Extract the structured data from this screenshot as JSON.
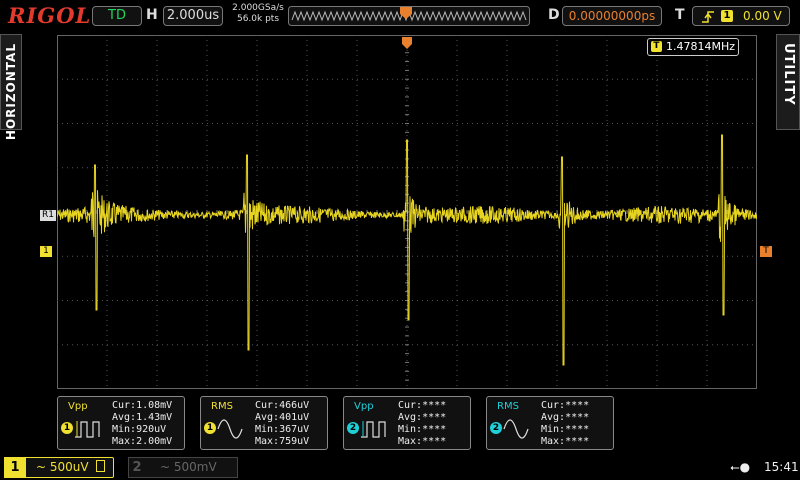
{
  "header": {
    "brand": "RIGOL",
    "run_state": "TD",
    "horizontal_label": "H",
    "timebase": "2.000us",
    "sample_rate": "2.000GSa/s",
    "memory_depth": "56.0k pts",
    "delay_label": "D",
    "delay": "0.00000000ps",
    "trigger_label": "T",
    "trigger_source": "1",
    "trigger_level": "0.00 V"
  },
  "side_tabs": {
    "left": "HORIZONTAL",
    "right": "UTILITY"
  },
  "markers": {
    "ref": "R1",
    "channel": "1",
    "trigger_pos": "T"
  },
  "frequency": {
    "icon": "T",
    "value": "1.47814MHz"
  },
  "measurements": [
    {
      "title": "Vpp",
      "channel": "1",
      "color": "#f0e030",
      "cur": "Cur:1.08mV",
      "avg": "Avg:1.43mV",
      "min": "Min:920uV",
      "max": "Max:2.00mV"
    },
    {
      "title": "RMS",
      "channel": "1",
      "color": "#f0e030",
      "cur": "Cur:466uV",
      "avg": "Avg:401uV",
      "min": "Min:367uV",
      "max": "Max:759uV"
    },
    {
      "title": "Vpp",
      "channel": "2",
      "color": "#1fd0d8",
      "cur": "Cur:****",
      "avg": "Avg:****",
      "min": "Min:****",
      "max": "Max:****"
    },
    {
      "title": "RMS",
      "channel": "2",
      "color": "#1fd0d8",
      "cur": "Cur:****",
      "avg": "Avg:****",
      "min": "Min:****",
      "max": "Max:****"
    }
  ],
  "channels": {
    "ch1": {
      "number": "1",
      "coupling": "~",
      "scale": "500uV"
    },
    "ch2": {
      "number": "2",
      "coupling": "~",
      "scale": "500mV"
    }
  },
  "status": {
    "time": "15:41"
  },
  "colors": {
    "ch1": "#f0e030",
    "ch2": "#1fd0d8",
    "trigger": "#e8802e",
    "brand": "#e23b2e"
  }
}
